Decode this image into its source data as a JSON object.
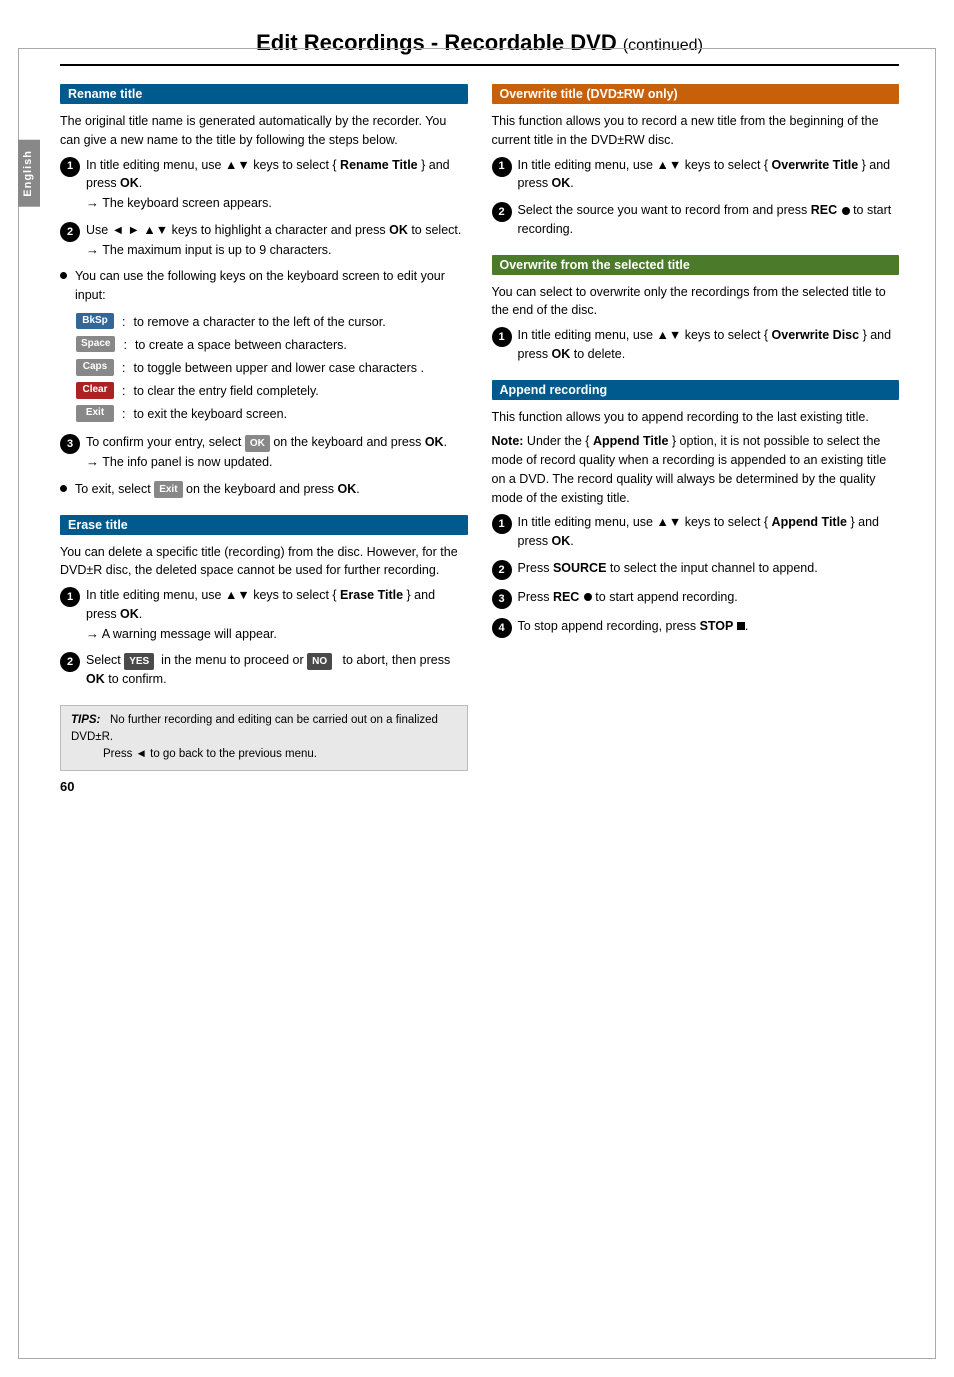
{
  "page": {
    "title": "Edit Recordings - Recordable DVD",
    "title_suffix": "(continued)",
    "page_number": "60",
    "english_tab": "English"
  },
  "tips": {
    "label": "TIPS:",
    "lines": [
      "No further recording and editing can be carried out on a finalized DVD±R.",
      "Press ◄ to go back to the previous menu."
    ]
  },
  "rename_title": {
    "header": "Rename title",
    "intro": "The original title name is generated automatically by the recorder. You can give a new name to the title by following the steps below.",
    "steps": [
      {
        "num": "1",
        "text": "In title editing menu, use ▲▼ keys to select { ",
        "bold": "Rename Title",
        "text2": " } and press ",
        "bold2": "OK",
        "text3": ".",
        "sub": "→ The keyboard screen appears."
      },
      {
        "num": "2",
        "text": "Use ◄ ► ▲▼ keys to highlight a character and press ",
        "bold": "OK",
        "text2": " to select.",
        "sub": "→ The maximum input is up to 9 characters."
      }
    ],
    "bullet": "You can use the following keys on the keyboard screen to edit your input:",
    "keys": [
      {
        "badge": "BkSp",
        "badge_color": "blue",
        "desc": "to remove a character to the left of the cursor."
      },
      {
        "badge": "Space",
        "badge_color": "gray",
        "desc": "to create a space between characters."
      },
      {
        "badge": "Caps",
        "badge_color": "gray",
        "desc": "to toggle between upper and lower case characters ."
      },
      {
        "badge": "Clear",
        "badge_color": "red-k",
        "desc": "to clear the entry field completely."
      },
      {
        "badge": "Exit",
        "badge_color": "gray",
        "desc": "to exit the keyboard screen."
      }
    ],
    "step3": {
      "num": "3",
      "text": "To confirm your entry, select ",
      "badge": "OK",
      "text2": " on the keyboard and press ",
      "bold": "OK",
      "text3": ".",
      "sub": "→ The info panel is now updated."
    },
    "step_exit": {
      "text": "To exit, select ",
      "badge": "Exit",
      "text2": " on the keyboard and press ",
      "bold": "OK",
      "text3": "."
    }
  },
  "erase_title": {
    "header": "Erase title",
    "intro": "You can delete a specific title (recording) from the disc. However, for the DVD±R disc, the deleted space cannot be used for further recording.",
    "steps": [
      {
        "num": "1",
        "text": "In title editing menu, use ▲▼ keys to select { ",
        "bold": "Erase Title",
        "text2": " } and press ",
        "bold2": "OK",
        "text3": ".",
        "sub": "→ A warning message will appear."
      },
      {
        "num": "2",
        "text_pre": "Select ",
        "badge_yes": "YES",
        "text_mid": " in the menu to proceed or ",
        "badge_no": "NO",
        "text_end": " to abort, then press ",
        "bold": "OK",
        "text_final": " to confirm."
      }
    ]
  },
  "overwrite_title": {
    "header": "Overwrite title (DVD±RW only)",
    "intro": "This function allows you to record a new title from the beginning of the current title in the DVD±RW disc.",
    "steps": [
      {
        "num": "1",
        "text": "In title editing menu, use ▲▼ keys to select { ",
        "bold": "Overwrite Title",
        "text2": " } and press ",
        "bold2": "OK",
        "text3": "."
      },
      {
        "num": "2",
        "text": "Select the source you want to record from and press ",
        "bold": "REC",
        "text2": " ● to start recording."
      }
    ]
  },
  "overwrite_selected": {
    "header": "Overwrite from the selected title",
    "intro": "You can select to overwrite only the recordings from the selected title to the end of the disc.",
    "steps": [
      {
        "num": "1",
        "text": "In title editing menu, use ▲▼ keys to select { ",
        "bold": "Overwrite Disc",
        "text2": " } and press ",
        "bold2": "OK",
        "text3": " to delete."
      }
    ]
  },
  "append_recording": {
    "header": "Append recording",
    "intro": "This function allows you to append recording to the last existing title.",
    "note": {
      "label": "Note:",
      "text": " Under the { ",
      "bold": "Append Title",
      "text2": " } option, it is not possible to select the mode of record quality when a recording is appended to an existing title on a DVD. The record quality will always be determined by the quality mode of the existing title."
    },
    "steps": [
      {
        "num": "1",
        "text": "In title editing menu, use ▲▼ keys to select { ",
        "bold": "Append Title",
        "text2": " } and press ",
        "bold2": "OK",
        "text3": "."
      },
      {
        "num": "2",
        "text": "Press ",
        "bold": "SOURCE",
        "text2": " to select the input channel to append."
      },
      {
        "num": "3",
        "text": "Press ",
        "bold": "REC",
        "text2": " ● to start append recording."
      },
      {
        "num": "4",
        "text": "To stop append recording, press ",
        "bold": "STOP",
        "text2": " ■."
      }
    ]
  }
}
